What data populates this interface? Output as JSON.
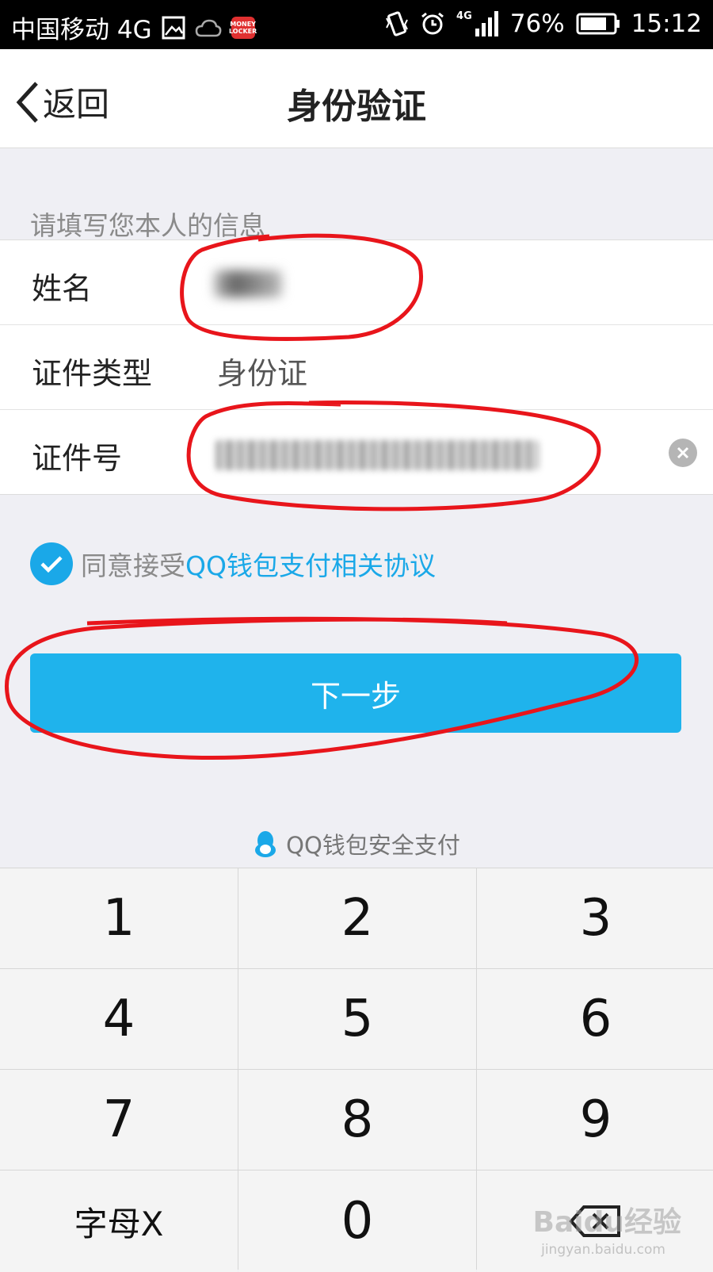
{
  "status_bar": {
    "carrier": "中国移动 4G",
    "app_badge": "MONEY LOCKER",
    "network_small": "4G",
    "battery": "76%",
    "time": "15:12"
  },
  "nav": {
    "back_label": "返回",
    "title": "身份验证"
  },
  "form": {
    "caption": "请填写您本人的信息",
    "rows": [
      {
        "label": "姓名",
        "value": ""
      },
      {
        "label": "证件类型",
        "value": "身份证"
      },
      {
        "label": "证件号",
        "value": ""
      }
    ]
  },
  "agreement": {
    "checked": true,
    "prefix": "同意接受",
    "link": "QQ钱包支付相关协议"
  },
  "next_button": "下一步",
  "keyboard": {
    "header": "QQ钱包安全支付",
    "keys": [
      "1",
      "2",
      "3",
      "4",
      "5",
      "6",
      "7",
      "8",
      "9",
      "字母X",
      "0",
      "delete"
    ]
  },
  "watermark": {
    "brand": "Baidu经验",
    "url": "jingyan.baidu.com"
  },
  "colors": {
    "accent": "#1fb3ec",
    "link": "#1aa8e8",
    "annotation": "#e8151b"
  }
}
